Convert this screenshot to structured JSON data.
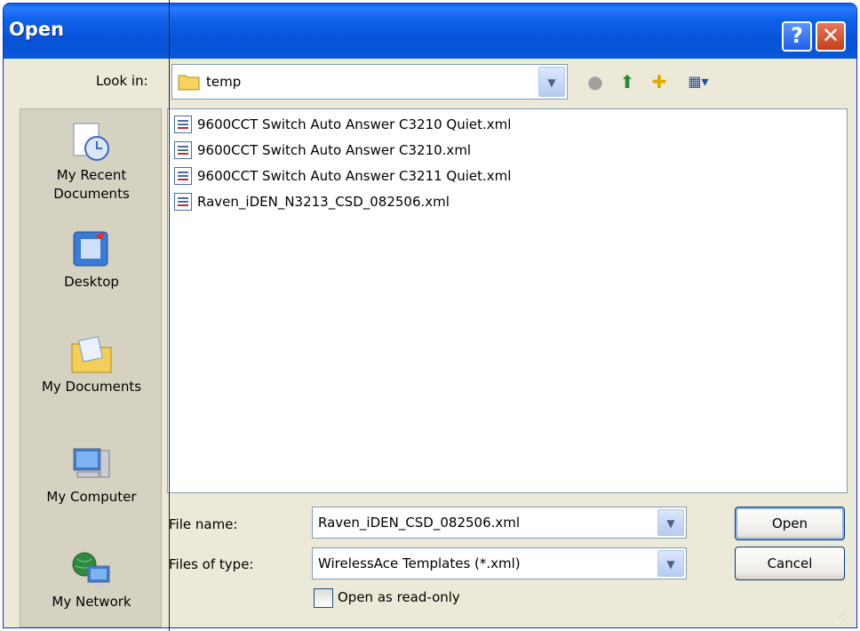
{
  "window": {
    "title": "Open"
  },
  "titlebar": {
    "help_glyph": "?",
    "close_glyph": "✕"
  },
  "lookin": {
    "label": "Look in:",
    "value": "temp",
    "icon": "folder-icon"
  },
  "toolbar": {
    "back_icon": "back-icon",
    "up_icon": "up-folder-icon",
    "newfolder_icon": "new-folder-icon",
    "views_icon": "views-menu-icon"
  },
  "places": [
    {
      "label": "My Recent Documents",
      "icon": "recent-documents-icon"
    },
    {
      "label": "Desktop",
      "icon": "desktop-icon"
    },
    {
      "label": "My Documents",
      "icon": "my-documents-icon"
    },
    {
      "label": "My Computer",
      "icon": "my-computer-icon"
    },
    {
      "label": "My Network",
      "icon": "my-network-icon"
    }
  ],
  "files": [
    "9600CCT Switch Auto Answer C3210 Quiet.xml",
    "9600CCT Switch Auto Answer C3210.xml",
    "9600CCT Switch Auto Answer C3211 Quiet.xml",
    "Raven_iDEN_N3213_CSD_082506.xml"
  ],
  "filename": {
    "label": "File name:",
    "value": "Raven_iDEN_CSD_082506.xml"
  },
  "filetype": {
    "label": "Files of type:",
    "value": "WirelessAce Templates (*.xml)"
  },
  "readonly": {
    "label": "Open as read-only",
    "checked": false
  },
  "buttons": {
    "open": "Open",
    "cancel": "Cancel"
  },
  "colors": {
    "titlebar": "#0653d8",
    "dialog_bg": "#ece9d8",
    "places_bg": "#d6d2c2"
  }
}
